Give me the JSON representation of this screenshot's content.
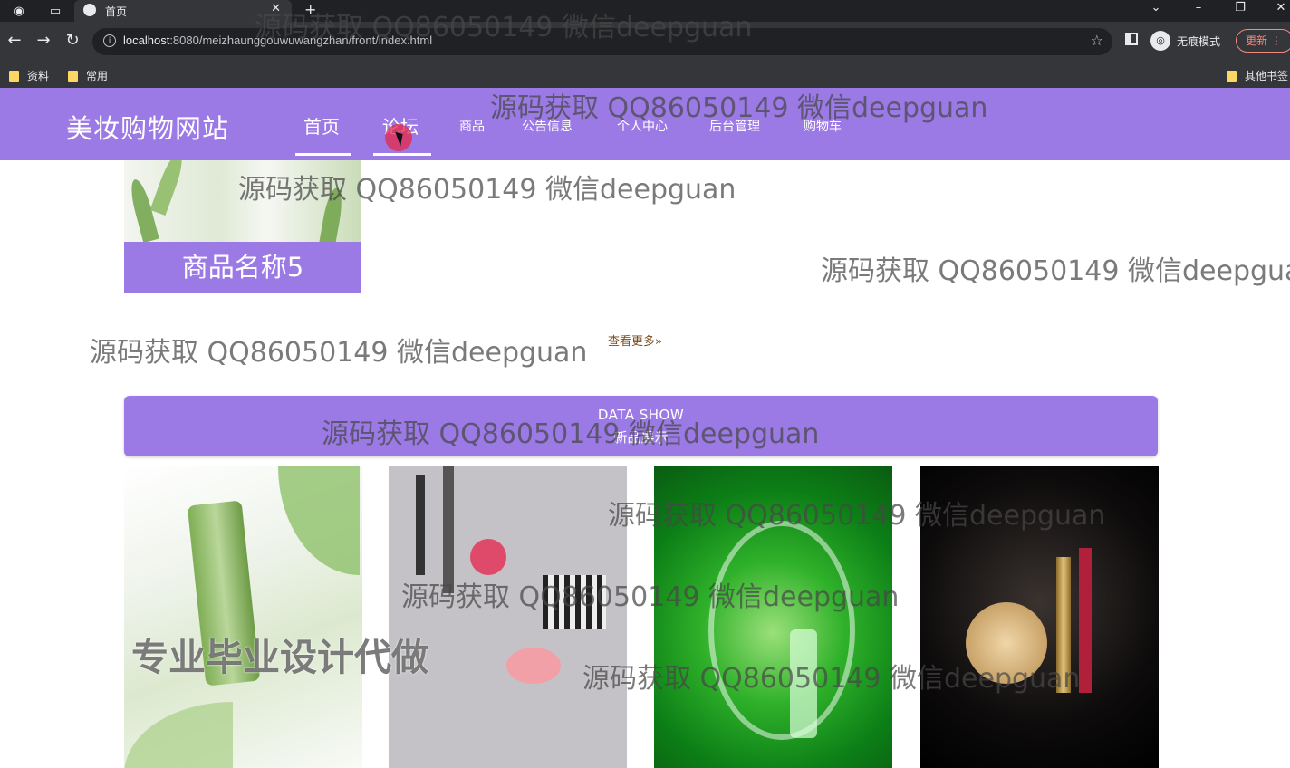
{
  "browser": {
    "tab_title": "首页",
    "url_host": "localhost",
    "url_rest": ":8080/meizhaunggouwuwangzhan/front/index.html",
    "incognito_label": "无痕模式",
    "update_label": "更新",
    "bookmarks": [
      "资料",
      "常用"
    ],
    "other_bookmarks": "其他书签"
  },
  "site": {
    "logo": "美妆购物网站",
    "nav": [
      "首页",
      "论坛",
      "商品",
      "公告信息",
      "个人中心",
      "后台管理",
      "购物车"
    ],
    "active_nav": "首页",
    "hover_nav": "论坛"
  },
  "main": {
    "product_name": "商品名称5",
    "more_link": "查看更多»",
    "section_en": "DATA SHOW",
    "section_cn": "新品展示"
  },
  "watermarks": {
    "text": "源码获取 QQ86050149 微信deepguan",
    "big": "专业毕业设计代做"
  },
  "colors": {
    "accent": "#9c7ae6",
    "chrome": "#202124"
  }
}
